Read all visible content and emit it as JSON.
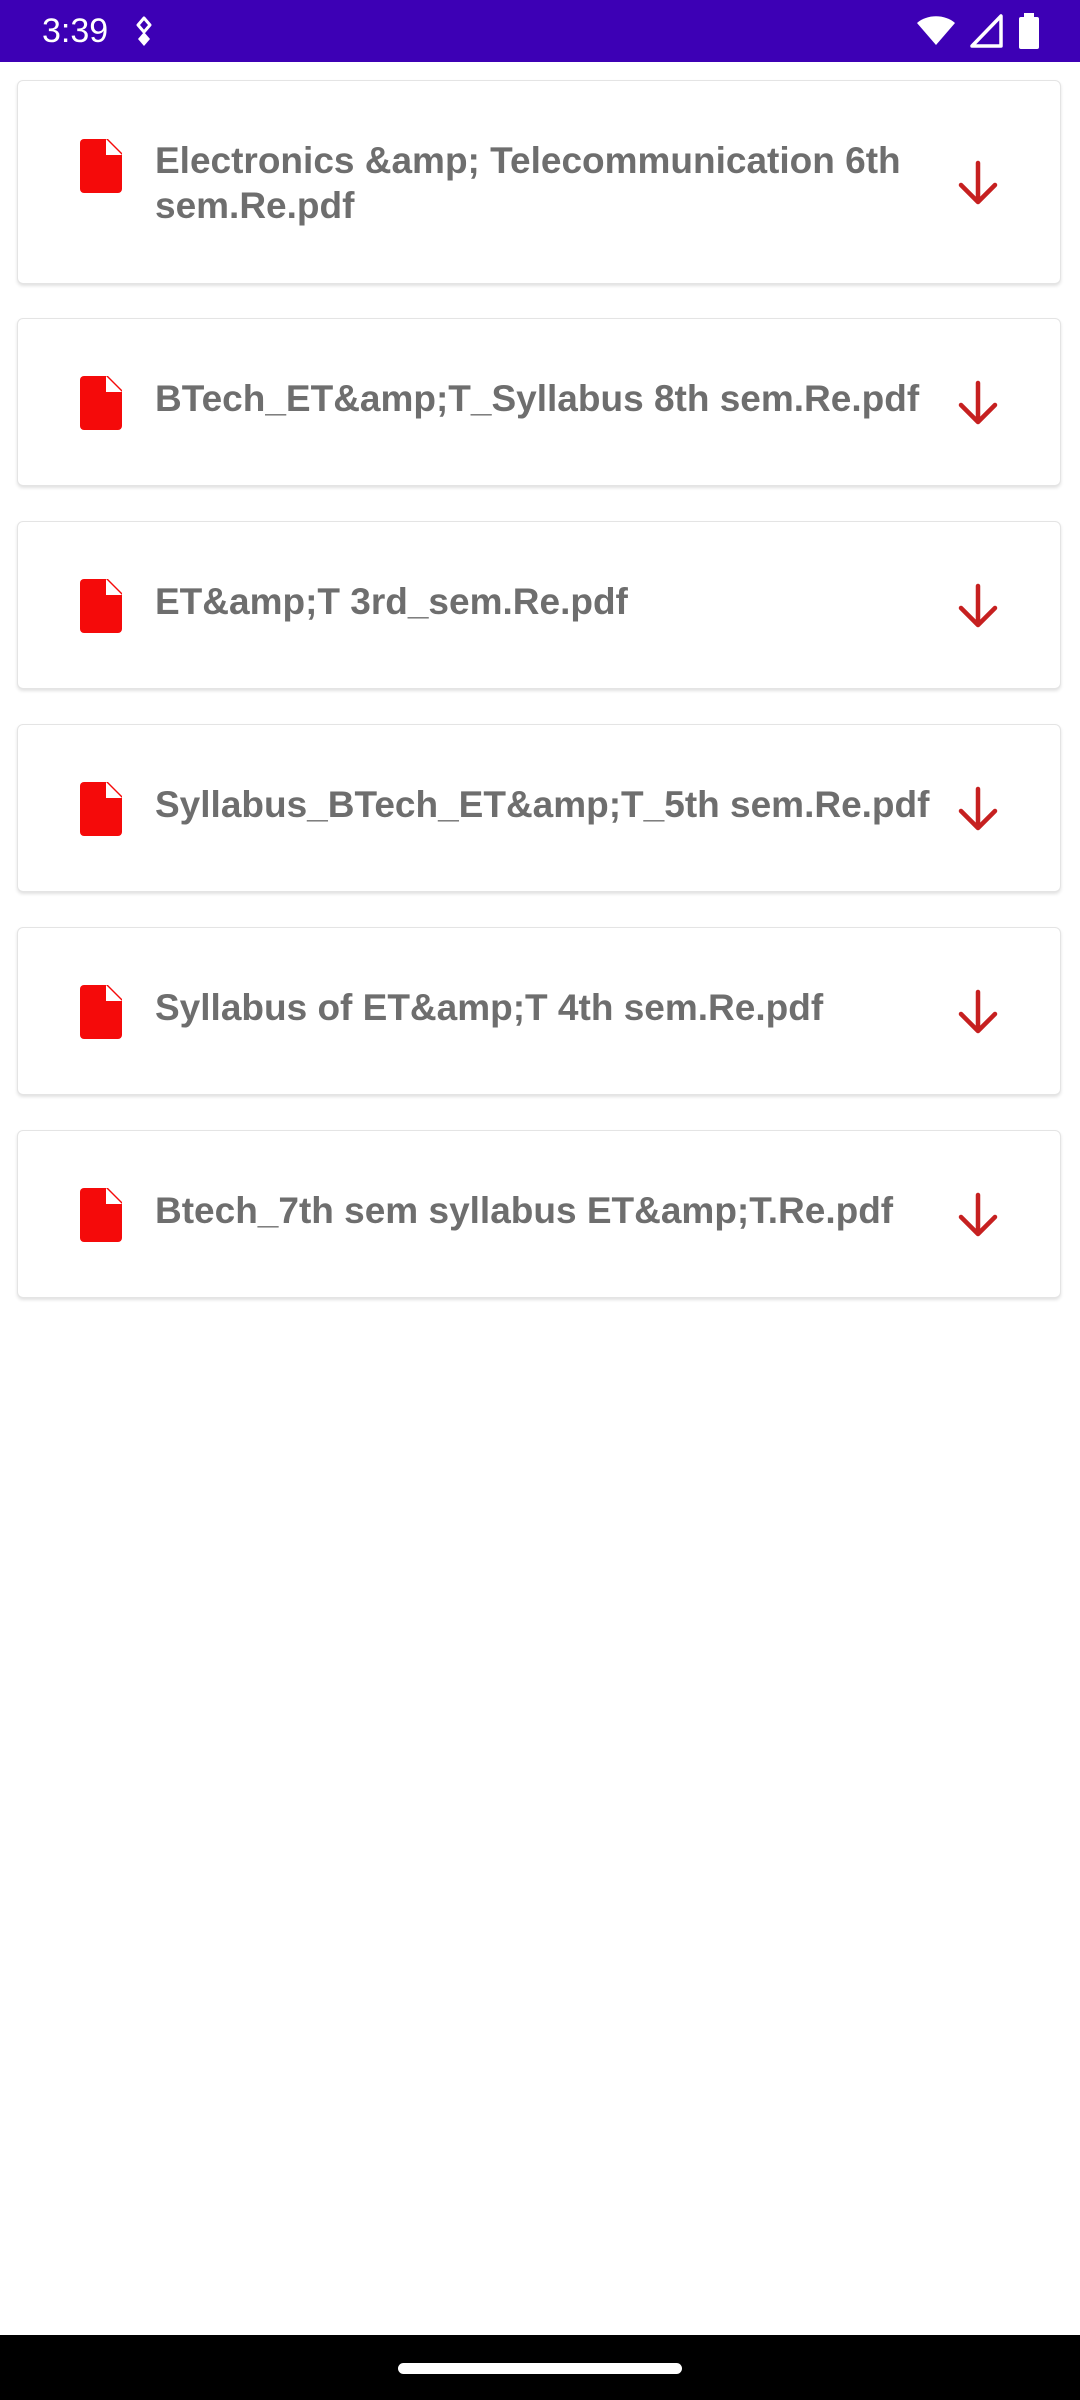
{
  "status_bar": {
    "time": "3:39",
    "background": "#3d00b5"
  },
  "files": [
    {
      "name": "Electronics &amp; Telecommunication 6th sem.Re.pdf"
    },
    {
      "name": "BTech_ET&amp;T_Syllabus 8th sem.Re.pdf"
    },
    {
      "name": "ET&amp;T 3rd_sem.Re.pdf"
    },
    {
      "name": "Syllabus_BTech_ET&amp;T_5th sem.Re.pdf"
    },
    {
      "name": "Syllabus of ET&amp;T 4th sem.Re.pdf"
    },
    {
      "name": "Btech_7th sem syllabus ET&amp;T.Re.pdf"
    }
  ],
  "icons": {
    "file": "pdf-file-icon",
    "download": "download-arrow-icon"
  },
  "colors": {
    "file_icon": "#f50a0a",
    "download_icon": "#c62020",
    "file_name_text": "#6e6e6e"
  }
}
